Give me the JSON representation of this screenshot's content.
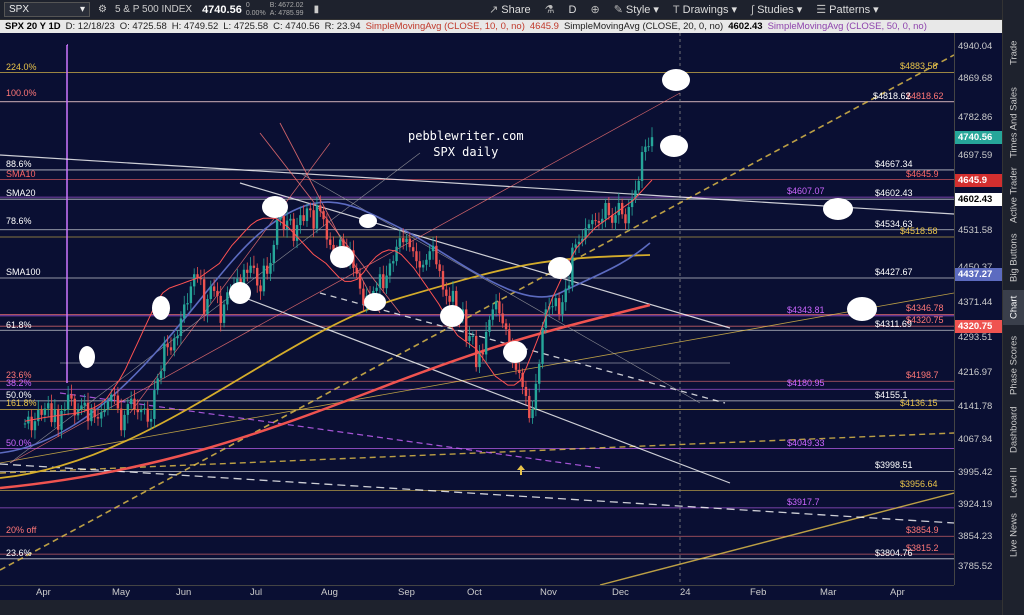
{
  "toolbar": {
    "symbol": "SPX",
    "index_name": "5 & P 500 INDEX",
    "last_price": "4740.56",
    "change_a": "0",
    "change_b": "0.00%",
    "bid": "4672.02",
    "ask": "4785.99",
    "share_label": "Share",
    "d_label": "D",
    "style_label": "Style",
    "drawings_label": "Drawings",
    "studies_label": "Studies",
    "patterns_label": "Patterns"
  },
  "legend": {
    "title": "SPX 20 Y 1D",
    "date": "D: 12/18/23",
    "open": "O: 4725.58",
    "high": "H: 4749.52",
    "low": "L: 4725.58",
    "close": "C: 4740.56",
    "range": "R: 23.94",
    "sma10_label": "SimpleMovingAvg (CLOSE, 10, 0, no)",
    "sma10_val": "4645.9",
    "sma20_label": "SimpleMovingAvg (CLOSE, 20, 0, no)",
    "sma20_val": "4602.43",
    "sma50_label": "SimpleMovingAvg (CLOSE, 50, 0, no)"
  },
  "sidebar": [
    "Trade",
    "Times And Sales",
    "Active Trader",
    "Big Buttons",
    "Chart",
    "Phase Scores",
    "Dashboard",
    "Level II",
    "Live News"
  ],
  "watermark": {
    "line1": "pebblewriter.com",
    "line2": "SPX daily"
  },
  "chart_data": {
    "type": "candlestick",
    "ylim": [
      3760,
      4940
    ],
    "y_ticks": [
      "4940.04",
      "4869.68",
      "4782.86",
      "4697.59",
      "4531.58",
      "4450.37",
      "4371.44",
      "4293.51",
      "4216.97",
      "4141.78",
      "4067.94",
      "3995.42",
      "3924.19",
      "3854.23",
      "3785.52"
    ],
    "x_ticks": [
      "Apr",
      "May",
      "Jun",
      "Jul",
      "Aug",
      "Sep",
      "Oct",
      "Nov",
      "Dec",
      "24",
      "Feb",
      "Mar",
      "Apr"
    ],
    "levels": [
      {
        "label": "$4883.58",
        "price": 4883.58,
        "color": "#e8c34a"
      },
      {
        "label": "$4818.62",
        "price": 4818.62,
        "color": "#ff7777"
      },
      {
        "label": "$4818.62",
        "price": 4818.62,
        "color": "#ffffff"
      },
      {
        "label": "$4667.34",
        "price": 4667.34,
        "color": "#ffffff"
      },
      {
        "label": "$4645.9",
        "price": 4645.9,
        "color": "#ff6666"
      },
      {
        "label": "$4607.07",
        "price": 4607.07,
        "color": "#cc66ff"
      },
      {
        "label": "$4602.43",
        "price": 4602.43,
        "color": "#ffffff"
      },
      {
        "label": "$4534.63",
        "price": 4534.63,
        "color": "#ffffff"
      },
      {
        "label": "$4518.58",
        "price": 4518.58,
        "color": "#e8c34a"
      },
      {
        "label": "$4427.67",
        "price": 4427.67,
        "color": "#ffffff"
      },
      {
        "label": "$4343.81",
        "price": 4343.81,
        "color": "#cc66ff"
      },
      {
        "label": "$4346.78",
        "price": 4346.78,
        "color": "#ff7777"
      },
      {
        "label": "$4320.75",
        "price": 4320.75,
        "color": "#ff7777"
      },
      {
        "label": "$4311.69",
        "price": 4311.69,
        "color": "#ffffff"
      },
      {
        "label": "$4198.7",
        "price": 4198.7,
        "color": "#ff7777"
      },
      {
        "label": "$4180.95",
        "price": 4180.95,
        "color": "#cc66ff"
      },
      {
        "label": "$4155.1",
        "price": 4155.1,
        "color": "#ffffff"
      },
      {
        "label": "$4136.15",
        "price": 4136.15,
        "color": "#e8c34a"
      },
      {
        "label": "$4049.33",
        "price": 4049.33,
        "color": "#cc66ff"
      },
      {
        "label": "$3998.51",
        "price": 3998.51,
        "color": "#ffffff"
      },
      {
        "label": "$3956.64",
        "price": 3956.64,
        "color": "#e8c34a"
      },
      {
        "label": "$3917.7",
        "price": 3917.7,
        "color": "#cc66ff"
      },
      {
        "label": "$3854.9",
        "price": 3854.9,
        "color": "#ff7777"
      },
      {
        "label": "$3815.2",
        "price": 3815.2,
        "color": "#ff7777"
      },
      {
        "label": "$3804.76",
        "price": 3804.76,
        "color": "#ffffff"
      }
    ],
    "left_labels": [
      {
        "label": "224.0%",
        "price": 4883,
        "color": "#e8c34a"
      },
      {
        "label": "100.0%",
        "price": 4825,
        "color": "#ff7777"
      },
      {
        "label": "88.6%",
        "price": 4668,
        "color": "#ffffff"
      },
      {
        "label": "SMA10",
        "price": 4646,
        "color": "#ff6666"
      },
      {
        "label": "SMA20",
        "price": 4603,
        "color": "#ffffff"
      },
      {
        "label": "78.6%",
        "price": 4540,
        "color": "#ffffff"
      },
      {
        "label": "SMA100",
        "price": 4428,
        "color": "#ffffff"
      },
      {
        "label": "61.8%",
        "price": 4310,
        "color": "#ffffff"
      },
      {
        "label": "23.6%",
        "price": 4200,
        "color": "#ff7777"
      },
      {
        "label": "38.2%",
        "price": 4182,
        "color": "#cc66ff"
      },
      {
        "label": "50.0%",
        "price": 4155,
        "color": "#ffffff"
      },
      {
        "label": "161.8%",
        "price": 4137,
        "color": "#e8c34a"
      },
      {
        "label": "50.0%",
        "price": 4049,
        "color": "#cc66ff"
      },
      {
        "label": "20% off",
        "price": 3855,
        "color": "#ff7777"
      },
      {
        "label": "23.6%",
        "price": 3804,
        "color": "#ffffff"
      }
    ],
    "price_tags": [
      {
        "label": "4740.56",
        "price": 4740.56,
        "bg": "#26a69a",
        "fg": "#ffffff"
      },
      {
        "label": "4645.9",
        "price": 4645.9,
        "bg": "#d32f2f",
        "fg": "#ffffff"
      },
      {
        "label": "4602.43",
        "price": 4602.43,
        "bg": "#ffffff",
        "fg": "#000000"
      },
      {
        "label": "4437.27",
        "price": 4437.27,
        "bg": "#5c6bc0",
        "fg": "#ffffff"
      },
      {
        "label": "4320.75",
        "price": 4320.75,
        "bg": "#ef5350",
        "fg": "#ffffff"
      }
    ],
    "closes": [
      4105,
      4120,
      4090,
      4110,
      4135,
      4124,
      4138,
      4150,
      4108,
      4137,
      4091,
      4133,
      4136,
      4169,
      4160,
      4123,
      4137,
      4145,
      4151,
      4110,
      4138,
      4119,
      4116,
      4130,
      4136,
      4154,
      4169,
      4167,
      4138,
      4090,
      4124,
      4148,
      4160,
      4137,
      4130,
      4135,
      4138,
      4109,
      4115,
      4179,
      4205,
      4221,
      4282,
      4274,
      4267,
      4294,
      4299,
      4338,
      4369,
      4372,
      4409,
      4436,
      4427,
      4425,
      4348,
      4381,
      4409,
      4399,
      4388,
      4328,
      4369,
      4396,
      4398,
      4411,
      4426,
      4411,
      4446,
      4439,
      4455,
      4450,
      4411,
      4398,
      4455,
      4437,
      4461,
      4501,
      4557,
      4565,
      4536,
      4555,
      4559,
      4510,
      4545,
      4567,
      4554,
      4582,
      4578,
      4537,
      4589,
      4576,
      4558,
      4513,
      4501,
      4478,
      4468,
      4513,
      4499,
      4464,
      4489,
      4450,
      4437,
      4404,
      4370,
      4388,
      4376,
      4399,
      4406,
      4436,
      4405,
      4433,
      4460,
      4465,
      4497,
      4516,
      4507,
      4515,
      4496,
      4487,
      4465,
      4451,
      4457,
      4468,
      4487,
      4499,
      4458,
      4443,
      4402,
      4388,
      4375,
      4399,
      4346,
      4337,
      4358,
      4288,
      4299,
      4299,
      4230,
      4263,
      4258,
      4308,
      4335,
      4358,
      4376,
      4349,
      4327,
      4314,
      4278,
      4247,
      4224,
      4217,
      4186,
      4166,
      4117,
      4137,
      4193,
      4237,
      4317,
      4358,
      4365,
      4365,
      4383,
      4347,
      4374,
      4404,
      4411,
      4495,
      4502,
      4508,
      4515,
      4538,
      4547,
      4556,
      4554,
      4550,
      4559,
      4594,
      4567,
      4550,
      4567,
      4594,
      4569,
      4549,
      4585,
      4604,
      4622,
      4643,
      4707,
      4719,
      4720,
      4740
    ],
    "sma10": [
      4110,
      4113,
      4115,
      4118,
      4120,
      4122,
      4124,
      4126,
      4127,
      4130,
      4135,
      4140,
      4148,
      4160,
      4180,
      4200,
      4225,
      4255,
      4285,
      4315,
      4345,
      4375,
      4395,
      4405,
      4410,
      4415,
      4420,
      4425,
      4430,
      4440,
      4450,
      4460,
      4480,
      4500,
      4515,
      4530,
      4545,
      4555,
      4560,
      4560,
      4560,
      4550,
      4540,
      4525,
      4510,
      4495,
      4480,
      4470,
      4460,
      4445,
      4430,
      4420,
      4420,
      4425,
      4440,
      4460,
      4475,
      4485,
      4490,
      4488,
      4480,
      4465,
      4450,
      4430,
      4410,
      4390,
      4370,
      4345,
      4320,
      4300,
      4290,
      4280,
      4270,
      4250,
      4230,
      4210,
      4200,
      4190,
      4190,
      4200,
      4230,
      4265,
      4300,
      4340,
      4380,
      4410,
      4440,
      4470,
      4495,
      4510,
      4525,
      4540,
      4550,
      4560,
      4570,
      4580,
      4590,
      4600,
      4615,
      4630,
      4645
    ]
  }
}
